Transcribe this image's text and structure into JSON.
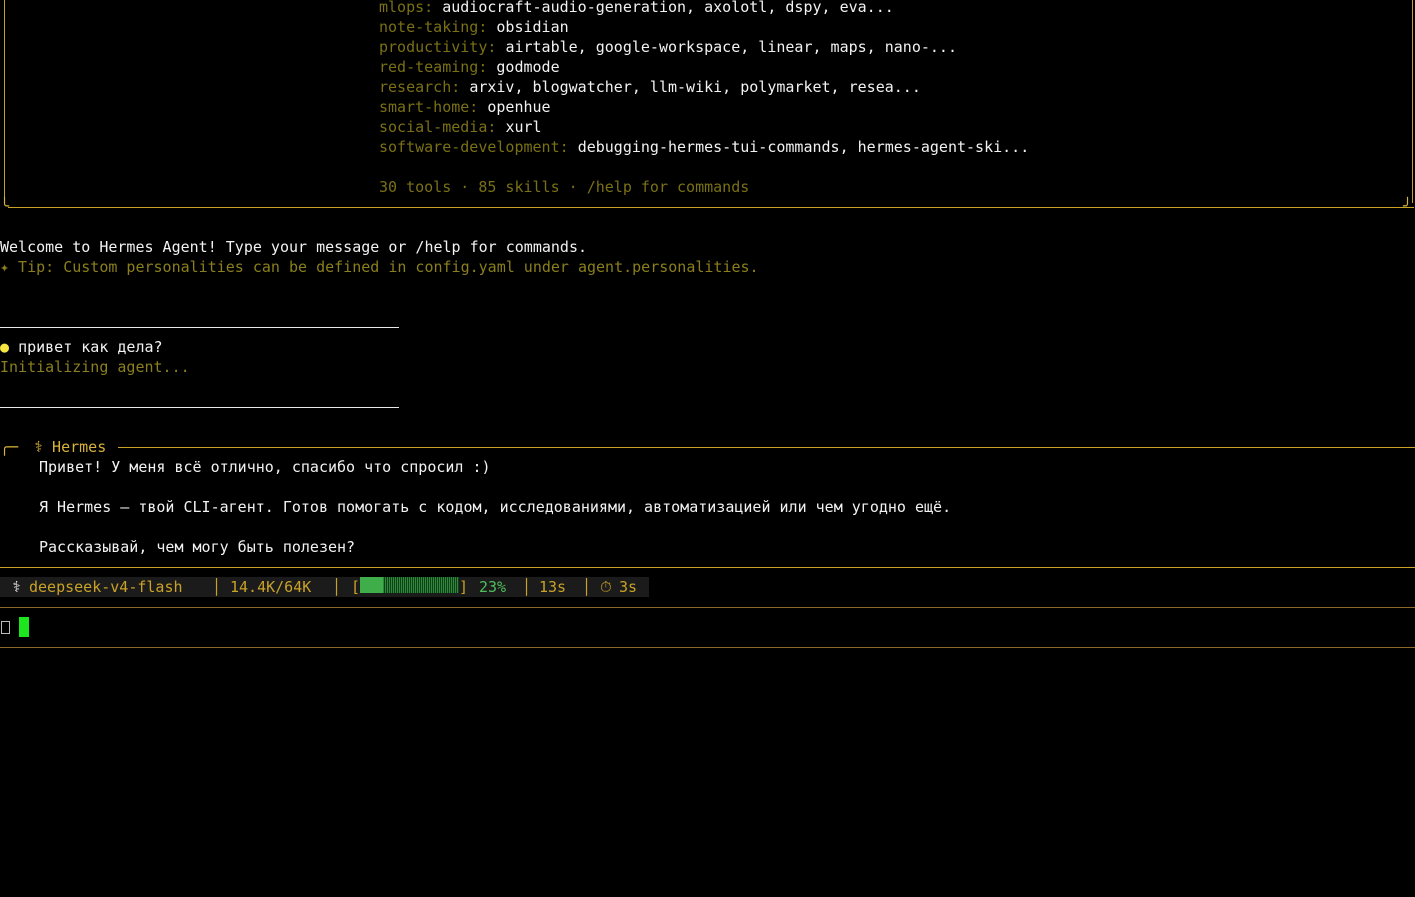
{
  "skills_panel": {
    "rows": [
      {
        "category": "mlops:",
        "items": "audiocraft-audio-generation, axolotl, dspy, eva..."
      },
      {
        "category": "note-taking:",
        "items": "obsidian"
      },
      {
        "category": "productivity:",
        "items": "airtable, google-workspace, linear, maps, nano-..."
      },
      {
        "category": "red-teaming:",
        "items": "godmode"
      },
      {
        "category": "research:",
        "items": "arxiv, blogwatcher, llm-wiki, polymarket, resea..."
      },
      {
        "category": "smart-home:",
        "items": "openhue"
      },
      {
        "category": "social-media:",
        "items": "xurl"
      },
      {
        "category": "software-development:",
        "items": "debugging-hermes-tui-commands, hermes-agent-ski..."
      }
    ],
    "summary": "30 tools · 85 skills · /help for commands"
  },
  "welcome": "Welcome to Hermes Agent! Type your message or /help for commands.",
  "tip": "✦ Tip: Custom personalities can be defined in config.yaml under agent.personalities.",
  "user_message": {
    "bullet": "●",
    "text": "привет как дела?",
    "status": "Initializing agent..."
  },
  "response": {
    "header": "⚕ Hermes",
    "lines": [
      "Привет! У меня всё отлично, спасибо что спросил :)",
      "Я Hermes — твой CLI-агент. Готов помогать с кодом, исследованиями, автоматизацией или чем угодно ещё.",
      "Рассказывай, чем могу быть полезен?"
    ]
  },
  "status_bar": {
    "icon": "⚕",
    "model": "deepseek-v4-flash",
    "tokens": "14.4K/64K",
    "context_percent_label": "23%",
    "context_fraction": 0.23,
    "elapsed": "13s",
    "timer_icon": "⏱",
    "timer": "3s"
  },
  "colors": {
    "border": "#c9a227",
    "category": "#7a7016",
    "accent_green": "#1ee61e",
    "bullet": "#f5e642"
  },
  "icons": [
    "caduceus-icon",
    "sparkle-icon",
    "timer-icon",
    "prompt-box-icon"
  ]
}
